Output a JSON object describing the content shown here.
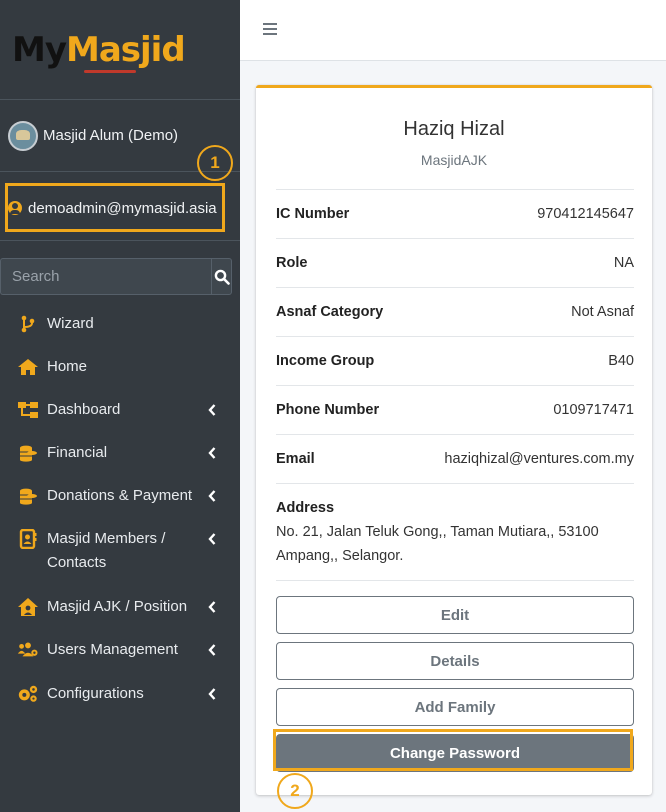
{
  "brand": {
    "part1": "My",
    "part2": "Masjid"
  },
  "sidebar": {
    "masjid_name": "Masjid Alum (Demo)",
    "user_email": "demoadmin@mymasjid.asia",
    "search_placeholder": "Search",
    "items": [
      {
        "label": "Wizard",
        "icon": "wizard-icon",
        "has_children": false
      },
      {
        "label": "Home",
        "icon": "home-icon",
        "has_children": false
      },
      {
        "label": "Dashboard",
        "icon": "sitemap-icon",
        "has_children": true
      },
      {
        "label": "Financial",
        "icon": "coins-icon",
        "has_children": true
      },
      {
        "label": "Donations & Payment",
        "icon": "coins-icon",
        "has_children": true
      },
      {
        "label": "Masjid Members / Contacts",
        "icon": "address-book-icon",
        "has_children": true
      },
      {
        "label": "Masjid AJK / Position",
        "icon": "house-user-icon",
        "has_children": true
      },
      {
        "label": "Users Management",
        "icon": "users-cog-icon",
        "has_children": true
      },
      {
        "label": "Configurations",
        "icon": "cogs-icon",
        "has_children": true
      }
    ]
  },
  "annotations": {
    "step1": "1",
    "step2": "2"
  },
  "profile": {
    "name": "Haziq Hizal",
    "role": "MasjidAJK",
    "fields": [
      {
        "label": "IC Number",
        "value": "970412145647"
      },
      {
        "label": "Role",
        "value": "NA"
      },
      {
        "label": "Asnaf Category",
        "value": "Not Asnaf"
      },
      {
        "label": "Income Group",
        "value": "B40"
      },
      {
        "label": "Phone Number",
        "value": "0109717471"
      },
      {
        "label": "Email",
        "value": "haziqhizal@ventures.com.my"
      }
    ],
    "address_label": "Address",
    "address_value": "No. 21, Jalan Teluk Gong,, Taman Mutiara,, 53100 Ampang,, Selangor."
  },
  "buttons": {
    "edit": "Edit",
    "details": "Details",
    "add_family": "Add Family",
    "change_password": "Change Password"
  },
  "colors": {
    "accent": "#f0a81c",
    "sidebar": "#343a40",
    "button": "#6c757d"
  }
}
